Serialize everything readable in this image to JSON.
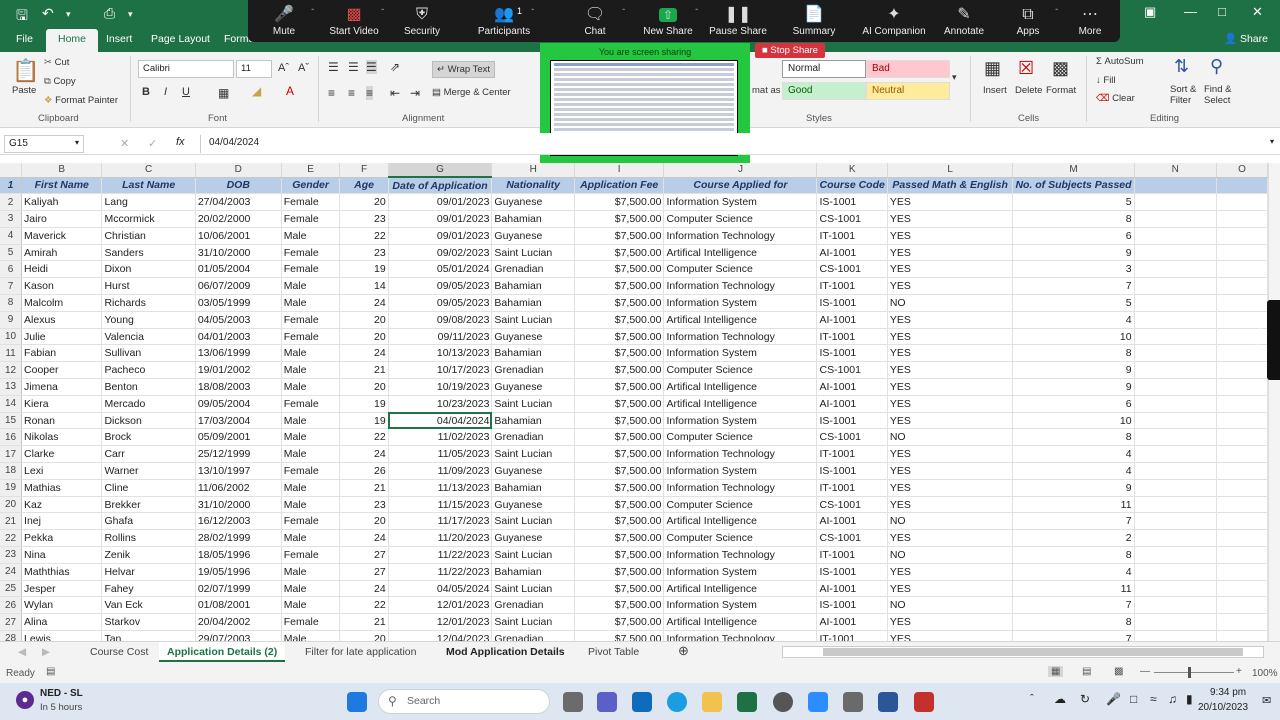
{
  "zoom_toolbar": {
    "mute": "Mute",
    "start_video": "Start Video",
    "security": "Security",
    "participants": "Participants",
    "participants_count": "1",
    "chat": "Chat",
    "new_share": "New Share",
    "pause_share": "Pause Share",
    "summary": "Summary",
    "ai_companion": "AI Companion",
    "annotate": "Annotate",
    "apps": "Apps",
    "more": "More"
  },
  "share": {
    "banner": "You are screen sharing",
    "stop": "Stop Share"
  },
  "ribbon_tabs": [
    "File",
    "Home",
    "Insert",
    "Page Layout",
    "Formu"
  ],
  "share_label": "Share",
  "clipboard": {
    "paste": "Paste",
    "cut": "Cut",
    "copy": "Copy",
    "format_painter": "Format Painter",
    "group": "Clipboard"
  },
  "font": {
    "name": "Calibri",
    "size": "11",
    "bold": "B",
    "italic": "I",
    "underline": "U",
    "group": "Font"
  },
  "alignment": {
    "wrap_text": "Wrap Text",
    "merge_center": "Merge & Center",
    "group": "Alignment"
  },
  "styles": {
    "normal": "Normal",
    "bad": "Bad",
    "good": "Good",
    "neutral": "Neutral",
    "format_as": "mat as",
    "group": "Styles"
  },
  "cells": {
    "insert": "Insert",
    "delete": "Delete",
    "format": "Format",
    "group": "Cells"
  },
  "editing": {
    "autosum": "AutoSum",
    "fill": "Fill",
    "clear": "Clear",
    "sort_filter": "Sort & Filter",
    "find_select": "Find & Select",
    "group": "Editing"
  },
  "formula_bar": {
    "name_box": "G15",
    "fx": "fx",
    "value": "04/04/2024"
  },
  "columns": [
    "B",
    "C",
    "D",
    "E",
    "F",
    "G",
    "H",
    "I",
    "J",
    "K",
    "L",
    "M",
    "N",
    "O"
  ],
  "headers": [
    "First Name",
    "Last Name",
    "DOB",
    "Gender",
    "Age",
    "Date of Application",
    "Nationality",
    "Application Fee",
    "Course Applied for",
    "Course Code",
    "Passed Math & English",
    "No. of Subjects Passed"
  ],
  "rows": [
    [
      "Kaliyah",
      "Lang",
      "27/04/2003",
      "Female",
      "20",
      "09/01/2023",
      "Guyanese",
      "$7,500.00",
      "Information System",
      "IS-1001",
      "YES",
      "5"
    ],
    [
      "Jairo",
      "Mccormick",
      "20/02/2000",
      "Female",
      "23",
      "09/01/2023",
      "Bahamian",
      "$7,500.00",
      "Computer Science",
      "CS-1001",
      "YES",
      "8"
    ],
    [
      "Maverick",
      "Christian",
      "10/06/2001",
      "Male",
      "22",
      "09/01/2023",
      "Guyanese",
      "$7,500.00",
      "Information Technology",
      "IT-1001",
      "YES",
      "6"
    ],
    [
      "Amirah",
      "Sanders",
      "31/10/2000",
      "Female",
      "23",
      "09/02/2023",
      "Saint Lucian",
      "$7,500.00",
      "Artifical Intelligence",
      "AI-1001",
      "YES",
      "9"
    ],
    [
      "Heidi",
      "Dixon",
      "01/05/2004",
      "Female",
      "19",
      "05/01/2024",
      "Grenadian",
      "$7,500.00",
      "Computer Science",
      "CS-1001",
      "YES",
      "3"
    ],
    [
      "Kason",
      "Hurst",
      "06/07/2009",
      "Male",
      "14",
      "09/05/2023",
      "Bahamian",
      "$7,500.00",
      "Information Technology",
      "IT-1001",
      "YES",
      "7"
    ],
    [
      "Malcolm",
      "Richards",
      "03/05/1999",
      "Male",
      "24",
      "09/05/2023",
      "Bahamian",
      "$7,500.00",
      "Information System",
      "IS-1001",
      "NO",
      "5"
    ],
    [
      "Alexus",
      "Young",
      "04/05/2003",
      "Female",
      "20",
      "09/08/2023",
      "Saint Lucian",
      "$7,500.00",
      "Artifical Intelligence",
      "AI-1001",
      "YES",
      "4"
    ],
    [
      "Julie",
      "Valencia",
      "04/01/2003",
      "Female",
      "20",
      "09/11/2023",
      "Guyanese",
      "$7,500.00",
      "Information Technology",
      "IT-1001",
      "YES",
      "10"
    ],
    [
      "Fabian",
      "Sullivan",
      "13/06/1999",
      "Male",
      "24",
      "10/13/2023",
      "Bahamian",
      "$7,500.00",
      "Information System",
      "IS-1001",
      "YES",
      "8"
    ],
    [
      "Cooper",
      "Pacheco",
      "19/01/2002",
      "Male",
      "21",
      "10/17/2023",
      "Grenadian",
      "$7,500.00",
      "Computer Science",
      "CS-1001",
      "YES",
      "9"
    ],
    [
      "Jimena",
      "Benton",
      "18/08/2003",
      "Male",
      "20",
      "10/19/2023",
      "Guyanese",
      "$7,500.00",
      "Artifical Intelligence",
      "AI-1001",
      "YES",
      "9"
    ],
    [
      "Kiera",
      "Mercado",
      "09/05/2004",
      "Female",
      "19",
      "10/23/2023",
      "Saint Lucian",
      "$7,500.00",
      "Artifical Intelligence",
      "AI-1001",
      "YES",
      "6"
    ],
    [
      "Ronan",
      "Dickson",
      "17/03/2004",
      "Male",
      "19",
      "04/04/2024",
      "Bahamian",
      "$7,500.00",
      "Information System",
      "IS-1001",
      "YES",
      "10"
    ],
    [
      "Nikolas",
      "Brock",
      "05/09/2001",
      "Male",
      "22",
      "11/02/2023",
      "Grenadian",
      "$7,500.00",
      "Computer Science",
      "CS-1001",
      "NO",
      "8"
    ],
    [
      "Clarke",
      "Carr",
      "25/12/1999",
      "Male",
      "24",
      "11/05/2023",
      "Saint Lucian",
      "$7,500.00",
      "Information Technology",
      "IT-1001",
      "YES",
      "4"
    ],
    [
      "Lexi",
      "Warner",
      "13/10/1997",
      "Female",
      "26",
      "11/09/2023",
      "Guyanese",
      "$7,500.00",
      "Information System",
      "IS-1001",
      "YES",
      "4"
    ],
    [
      "Mathias",
      "Cline",
      "11/06/2002",
      "Male",
      "21",
      "11/13/2023",
      "Bahamian",
      "$7,500.00",
      "Information Technology",
      "IT-1001",
      "YES",
      "9"
    ],
    [
      "Kaz",
      "Brekker",
      "31/10/2000",
      "Male",
      "23",
      "11/15/2023",
      "Guyanese",
      "$7,500.00",
      "Computer Science",
      "CS-1001",
      "YES",
      "11"
    ],
    [
      "Inej",
      "Ghafa",
      "16/12/2003",
      "Female",
      "20",
      "11/17/2023",
      "Saint Lucian",
      "$7,500.00",
      "Artifical Intelligence",
      "AI-1001",
      "NO",
      "7"
    ],
    [
      "Pekka",
      "Rollins",
      "28/02/1999",
      "Male",
      "24",
      "11/20/2023",
      "Guyanese",
      "$7,500.00",
      "Computer Science",
      "CS-1001",
      "YES",
      "2"
    ],
    [
      "Nina",
      "Zenik",
      "18/05/1996",
      "Female",
      "27",
      "11/22/2023",
      "Saint Lucian",
      "$7,500.00",
      "Information Technology",
      "IT-1001",
      "NO",
      "8"
    ],
    [
      "Maththias",
      "Helvar",
      "19/05/1996",
      "Male",
      "27",
      "11/22/2023",
      "Bahamian",
      "$7,500.00",
      "Information System",
      "IS-1001",
      "YES",
      "4"
    ],
    [
      "Jesper",
      "Fahey",
      "02/07/1999",
      "Male",
      "24",
      "04/05/2024",
      "Saint Lucian",
      "$7,500.00",
      "Artifical Intelligence",
      "AI-1001",
      "YES",
      "11"
    ],
    [
      "Wylan",
      "Van Eck",
      "01/08/2001",
      "Male",
      "22",
      "12/01/2023",
      "Grenadian",
      "$7,500.00",
      "Information System",
      "IS-1001",
      "NO",
      "7"
    ],
    [
      "Alina",
      "Starkov",
      "20/04/2002",
      "Female",
      "21",
      "12/01/2023",
      "Saint Lucian",
      "$7,500.00",
      "Artifical Intelligence",
      "AI-1001",
      "YES",
      "8"
    ],
    [
      "Lewis",
      "Tan",
      "29/07/2003",
      "Male",
      "20",
      "12/04/2023",
      "Grenadian",
      "$7,500.00",
      "Information Technology",
      "IT-1001",
      "YES",
      "7"
    ]
  ],
  "sheet_tabs": [
    "Course Cost",
    "Application Details  (2)",
    "Filter for late application",
    "Mod Application Details",
    "Pivot Table"
  ],
  "status": {
    "ready": "Ready",
    "zoom": "100%"
  },
  "taskbar": {
    "weather_title": "NED - SL",
    "weather_sub": "In 5 hours",
    "search": "Search",
    "time": "9:34 pm",
    "date": "20/10/2023"
  },
  "colors": {
    "excel_green": "#1e7145",
    "header_fill": "#b7cde8",
    "zoom_bar": "#1b1b1b",
    "share_green": "#23c840",
    "stop_red": "#d6333f"
  }
}
